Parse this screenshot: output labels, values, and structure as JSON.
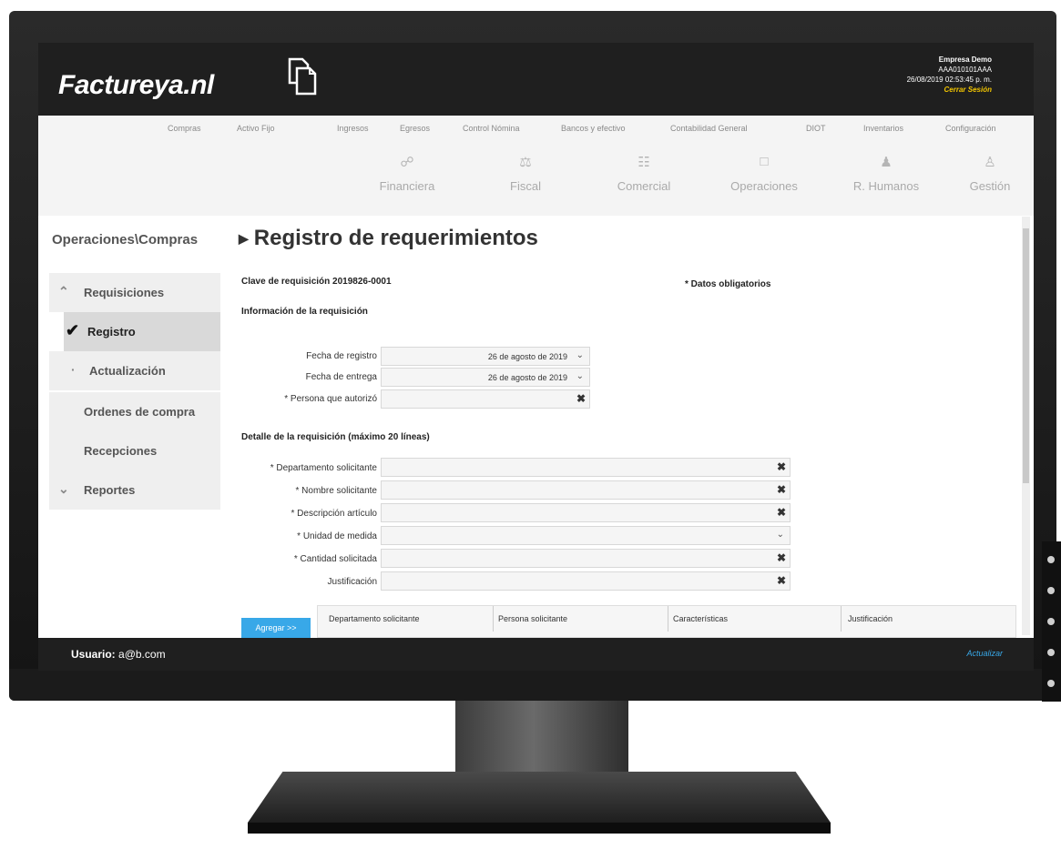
{
  "header": {
    "logo": "Factureya.nl",
    "company": "Empresa Demo",
    "rfc": "AAA010101AAA",
    "datetime": "26/08/2019 02:53:45 p. m.",
    "logout": "Cerrar Sesión"
  },
  "menu": [
    "Compras",
    "Activo Fijo",
    "Ingresos",
    "Egresos",
    "Control Nómina",
    "Bancos y efectivo",
    "Contabilidad General",
    "DIOT",
    "Inventarios",
    "Configuración"
  ],
  "modules": [
    {
      "label": "Financiera",
      "icon": "link-icon"
    },
    {
      "label": "Fiscal",
      "icon": "scale-icon"
    },
    {
      "label": "Comercial",
      "icon": "documents-icon"
    },
    {
      "label": "Operaciones",
      "icon": "monitor-icon"
    },
    {
      "label": "R. Humanos",
      "icon": "person-icon"
    },
    {
      "label": "Gestión",
      "icon": "manager-icon"
    }
  ],
  "sidebar": {
    "title": "Operaciones\\Compras",
    "items": [
      {
        "label": "Requisiciones"
      },
      {
        "label": "Registro"
      },
      {
        "label": "Actualización"
      },
      {
        "label": "Ordenes de compra"
      },
      {
        "label": "Recepciones"
      },
      {
        "label": "Reportes"
      }
    ]
  },
  "main": {
    "title": "Registro de requerimientos",
    "clave": "Clave de requisición 2019826-0001",
    "required_note": "* Datos obligatorios",
    "info_section": "Información de la requisición",
    "fecha_registro_label": "Fecha de registro",
    "fecha_registro_value": "26 de agosto de 2019",
    "fecha_entrega_label": "Fecha de entrega",
    "fecha_entrega_value": "26 de agosto de 2019",
    "persona_label": "* Persona que autorizó",
    "detail_section": "Detalle de la requisición (máximo 20 líneas)",
    "departamento_label": "* Departamento solicitante",
    "nombre_label": "* Nombre solicitante",
    "descripcion_label": "* Descripción artículo",
    "unidad_label": "* Unidad de medida",
    "cantidad_label": "* Cantidad solicitada",
    "justificacion_label": "Justificación",
    "add_button": "Agregar >>",
    "table_headers": [
      "Departamento solicitante",
      "Persona solicitante",
      "Características",
      "Justificación"
    ]
  },
  "footer": {
    "user_label": "Usuario:",
    "user_value": "a@b.com",
    "refresh": "Actualizar"
  },
  "colors": {
    "accent": "#38a8e8",
    "header_bg": "#1f1f1f",
    "logout": "#f2c500"
  }
}
